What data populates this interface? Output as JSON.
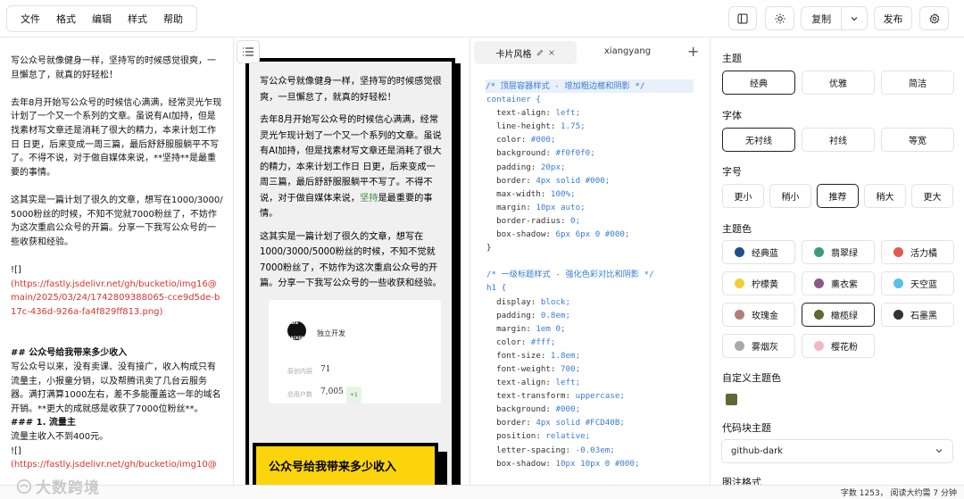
{
  "menu": [
    "文件",
    "格式",
    "编辑",
    "样式",
    "帮助"
  ],
  "toolbar": {
    "copy_label": "复制",
    "publish_label": "发布"
  },
  "editor": {
    "lines": [
      {
        "text": "写公众号就像健身一样，坚持写的时候感觉很爽，一旦懈怠了，就真的好轻松！",
        "kind": "normal"
      },
      {
        "text": "",
        "kind": "blank"
      },
      {
        "text": "去年8月开始写公众号的时候信心满满，经常灵光乍现计划了一个又一个系列的文章。虽说有AI加持，但是找素材写文章还是消耗了很大的精力，本来计划工作日 日更，后来变成一周三篇，最后舒舒服服躺平不写了。不得不说，对于做自媒体来说，**坚持**是最重要的事情。",
        "kind": "normal"
      },
      {
        "text": "",
        "kind": "blank"
      },
      {
        "text": "这其实是一篇计划了很久的文章，想写在1000/3000/5000粉丝的时候，不知不觉就7000粉丝了，不妨作为这次重启公众号的开篇。分享一下我写公众号的一些收获和经验。",
        "kind": "normal"
      },
      {
        "text": "",
        "kind": "blank"
      },
      {
        "text": "![]",
        "kind": "normal"
      },
      {
        "text": "(https://fastly.jsdelivr.net/gh/bucketio/img16@main/2025/03/24/1742809388065-cce9d5de-b17c-436d-926a-fa4f829ff813.png)",
        "kind": "link"
      },
      {
        "text": "",
        "kind": "blank"
      },
      {
        "text": "",
        "kind": "blank"
      },
      {
        "text": "## 公众号给我带来多少收入",
        "kind": "bold"
      },
      {
        "text": "写公众号以来，没有卖课、没有接广，收入构成只有流量主，小报童分销，以及帮腾讯卖了几台云服务器。满打满算1000左右，差不多能覆盖这一年的域名开销。**更大的成就感是收获了7000位粉丝**。",
        "kind": "normal"
      },
      {
        "text": "### 1. 流量主",
        "kind": "bold"
      },
      {
        "text": "流量主收入不到400元。",
        "kind": "normal"
      },
      {
        "text": "![]",
        "kind": "normal"
      },
      {
        "text": "(https://fastly.jsdelivr.net/gh/bucketio/img10@",
        "kind": "link"
      }
    ]
  },
  "preview": {
    "p1": "写公众号就像健身一样，坚持写的时候感觉很爽，一旦懈怠了，就真的好轻松！",
    "p2a": "去年8月开始写公众号的时候信心满满，经常灵光乍现计划了一个又一个系列的文章。虽说有AI加持，但是找素材写文章还是消耗了很大的精力，本来计划工作日 日更，后来变成一周三篇，最后舒舒服服躺平不写了。不得不说，对于做自媒体来说，",
    "p2hl": "坚持",
    "p2b": "是最重要的事情。",
    "p3": "这其实是一篇计划了很久的文章，想写在1000/3000/5000粉丝的时候，不知不觉就7000粉丝了，不妨作为这次重启公众号的开篇。分享一下我写公众号的一些收获和经验。",
    "embed": {
      "logo": "INDIE HACKER",
      "name": "独立开发",
      "row1_label": "原创内容",
      "row1_value": "71",
      "row2_label": "总用户数",
      "row2_value": "7,005",
      "row2_tag": "+1"
    },
    "h1": "公众号给我带来多少收入"
  },
  "css_panel": {
    "tab_active": "卡片风格",
    "tab2": "xiangyang",
    "lines": [
      {
        "t": "/* 顶层容器样式 - 增加粗边框和阴影 */",
        "k": "cmt"
      },
      {
        "t": "container {",
        "k": "sel"
      },
      {
        "p": "  text-align: ",
        "v": "left;"
      },
      {
        "p": "  line-height: ",
        "v": "1.75;"
      },
      {
        "p": "  color: ",
        "v": "#000;"
      },
      {
        "p": "  background: ",
        "v": "#f0f0f0;"
      },
      {
        "p": "  padding: ",
        "v": "20px;"
      },
      {
        "p": "  border: ",
        "v": "4px solid #000;"
      },
      {
        "p": "  max-width: ",
        "v": "100%;"
      },
      {
        "p": "  margin: ",
        "v": "10px auto;"
      },
      {
        "p": "  border-radius: ",
        "v": "0;"
      },
      {
        "p": "  box-shadow: ",
        "v": "6px 6px 0 #000;"
      },
      {
        "t": "}",
        "k": "plain"
      },
      {
        "t": "",
        "k": "plain"
      },
      {
        "t": "/* 一级标题样式 - 强化色彩对比和阴影 */",
        "k": "cmt"
      },
      {
        "t": "h1 {",
        "k": "sel"
      },
      {
        "p": "  display: ",
        "v": "block;"
      },
      {
        "p": "  padding: ",
        "v": "0.8em;"
      },
      {
        "p": "  margin: ",
        "v": "1em 0;"
      },
      {
        "p": "  color: ",
        "v": "#fff;"
      },
      {
        "p": "  font-size: ",
        "v": "1.8em;"
      },
      {
        "p": "  font-weight: ",
        "v": "700;"
      },
      {
        "p": "  text-align: ",
        "v": "left;"
      },
      {
        "p": "  text-transform: ",
        "v": "uppercase;"
      },
      {
        "p": "  background: ",
        "v": "#000;"
      },
      {
        "p": "  border: ",
        "v": "4px solid #FCD40B;"
      },
      {
        "p": "  position: ",
        "v": "relative;"
      },
      {
        "p": "  letter-spacing: ",
        "v": "-0.03em;"
      },
      {
        "p": "  box-shadow: ",
        "v": "10px 10px 0 #000;"
      }
    ]
  },
  "settings": {
    "theme_label": "主题",
    "themes": [
      "经典",
      "优雅",
      "简洁"
    ],
    "theme_active": 0,
    "font_label": "字体",
    "fonts": [
      "无衬线",
      "衬线",
      "等宽"
    ],
    "font_active": 0,
    "size_label": "字号",
    "sizes": [
      "更小",
      "稍小",
      "推荐",
      "稍大",
      "更大"
    ],
    "size_active": 2,
    "color_label": "主题色",
    "colors": [
      {
        "name": "经典蓝",
        "hex": "#1f4e8c"
      },
      {
        "name": "翡翠绿",
        "hex": "#3f9a7c"
      },
      {
        "name": "活力橘",
        "hex": "#e15b51"
      },
      {
        "name": "柠檬黄",
        "hex": "#f3cc3b"
      },
      {
        "name": "薰衣紫",
        "hex": "#8c5a88"
      },
      {
        "name": "天空蓝",
        "hex": "#5bbfe6"
      },
      {
        "name": "玫瑰金",
        "hex": "#b57d7a"
      },
      {
        "name": "橄榄绿",
        "hex": "#5c6b35"
      },
      {
        "name": "石墨黑",
        "hex": "#333333"
      },
      {
        "name": "雾烟灰",
        "hex": "#a8a8a8"
      },
      {
        "name": "樱花粉",
        "hex": "#f3b8c4"
      }
    ],
    "color_active": 7,
    "custom_color_label": "自定义主题色",
    "custom_color": "#5c6b35",
    "codeblock_label": "代码块主题",
    "codeblock_value": "github-dark",
    "next_label": "图注格式"
  },
  "status": {
    "text": "字数 1253，  阅读大约需 7 分钟"
  },
  "watermark": "大数跨境"
}
